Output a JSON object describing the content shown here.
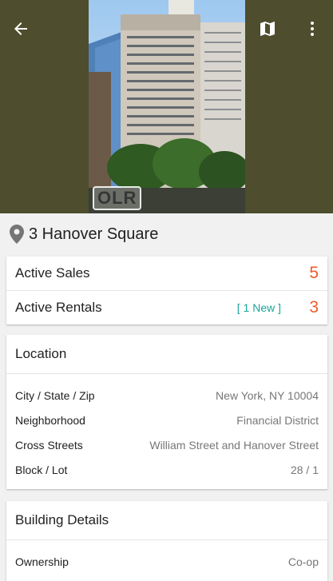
{
  "hero": {
    "photo_watermark": "OLR",
    "back_icon": "arrow-left-icon",
    "map_icon": "map-icon",
    "more_icon": "more-vertical-icon",
    "background_color": "#4e4d2d"
  },
  "address": {
    "icon": "location-pin-icon",
    "text": "3 Hanover Square"
  },
  "listings": {
    "active_sales_label": "Active Sales",
    "active_sales_count": "5",
    "active_rentals_label": "Active Rentals",
    "active_rentals_new": "[ 1 New ]",
    "active_rentals_count": "3",
    "count_color": "#ef5a2a",
    "new_color": "#1aa59a"
  },
  "location": {
    "title": "Location",
    "items": [
      {
        "label": "City / State / Zip",
        "value": "New York, NY 10004"
      },
      {
        "label": "Neighborhood",
        "value": "Financial District"
      },
      {
        "label": "Cross Streets",
        "value": "William Street and Hanover Street"
      },
      {
        "label": "Block / Lot",
        "value": "28 / 1"
      }
    ]
  },
  "building": {
    "title": "Building Details",
    "items": [
      {
        "label": "Ownership",
        "value": "Co-op"
      }
    ]
  }
}
